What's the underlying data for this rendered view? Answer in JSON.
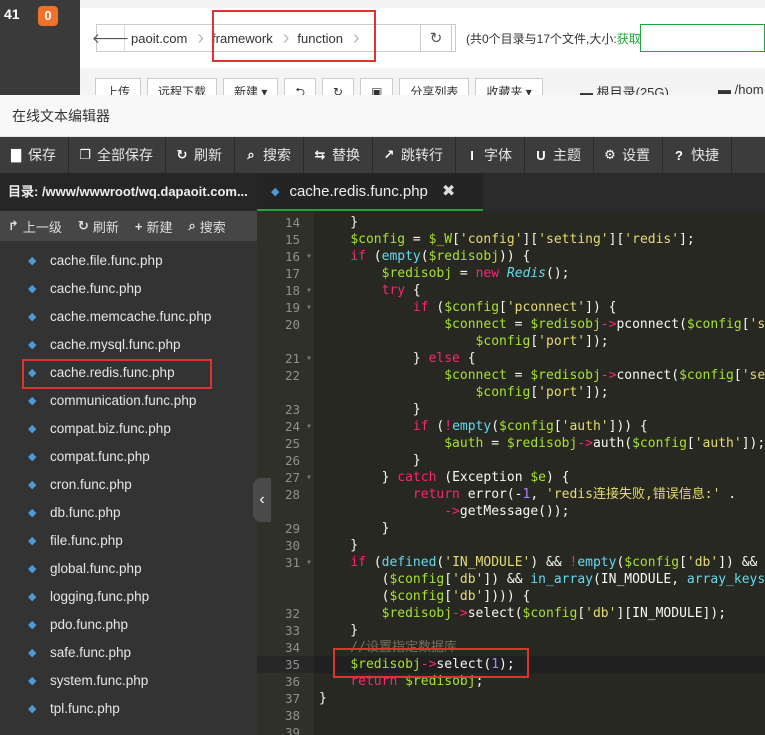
{
  "background": {
    "counter": "41",
    "badge": "0",
    "breadcrumb": [
      "paoit.com",
      "framework",
      "function"
    ],
    "info_text": "(共0个目录与17个文件,大小:",
    "info_action": "获取",
    "toolbar": [
      "上传",
      "远程下载",
      "新建 ▾",
      "⮌",
      "↻",
      "▣",
      "分享列表",
      "收藏夹 ▾"
    ],
    "root_dir": "根目录(25G)",
    "home_dir": "/hom"
  },
  "modal": {
    "title": "在线文本编辑器",
    "toolbar": [
      {
        "icon": "save-icon",
        "glyph": "▇",
        "label": "保存"
      },
      {
        "icon": "save-all-icon",
        "glyph": "❐",
        "label": "全部保存"
      },
      {
        "icon": "refresh-icon",
        "glyph": "↻",
        "label": "刷新"
      },
      {
        "icon": "search-icon",
        "glyph": "⌕",
        "label": "搜索"
      },
      {
        "icon": "replace-icon",
        "glyph": "⇆",
        "label": "替换"
      },
      {
        "icon": "goto-line-icon",
        "glyph": "↗",
        "label": "跳转行"
      },
      {
        "icon": "font-icon",
        "glyph": "I",
        "label": "字体"
      },
      {
        "icon": "theme-icon",
        "glyph": "U",
        "label": "主题"
      },
      {
        "icon": "settings-icon",
        "glyph": "⚙",
        "label": "设置"
      },
      {
        "icon": "shortcut-icon",
        "glyph": "?",
        "label": "快捷"
      }
    ],
    "sidebar": {
      "directory": "目录: /www/wwwroot/wq.dapaoit.com...",
      "tools": [
        {
          "icon": "up-level-icon",
          "glyph": "↱",
          "label": "上一级"
        },
        {
          "icon": "refresh-icon",
          "glyph": "↻",
          "label": "刷新"
        },
        {
          "icon": "plus-icon",
          "glyph": "+",
          "label": "新建"
        },
        {
          "icon": "search-icon",
          "glyph": "⌕",
          "label": "搜索"
        }
      ],
      "files": [
        "cache.file.func.php",
        "cache.func.php",
        "cache.memcache.func.php",
        "cache.mysql.func.php",
        "cache.redis.func.php",
        "communication.func.php",
        "compat.biz.func.php",
        "compat.func.php",
        "cron.func.php",
        "db.func.php",
        "file.func.php",
        "global.func.php",
        "logging.func.php",
        "pdo.func.php",
        "safe.func.php",
        "system.func.php",
        "tpl.func.php"
      ]
    },
    "tab": {
      "label": "cache.redis.func.php",
      "close": "✖"
    },
    "editor": {
      "gutter": [
        {
          "n": "14",
          "fold": false
        },
        {
          "n": "15",
          "fold": false
        },
        {
          "n": "16",
          "fold": true
        },
        {
          "n": "17",
          "fold": false
        },
        {
          "n": "18",
          "fold": true
        },
        {
          "n": "19",
          "fold": true
        },
        {
          "n": "20",
          "fold": false
        },
        {
          "n": "",
          "fold": false
        },
        {
          "n": "21",
          "fold": true
        },
        {
          "n": "22",
          "fold": false
        },
        {
          "n": "",
          "fold": false
        },
        {
          "n": "23",
          "fold": false
        },
        {
          "n": "24",
          "fold": true
        },
        {
          "n": "25",
          "fold": false
        },
        {
          "n": "26",
          "fold": false
        },
        {
          "n": "27",
          "fold": true
        },
        {
          "n": "28",
          "fold": false
        },
        {
          "n": "",
          "fold": false
        },
        {
          "n": "29",
          "fold": false
        },
        {
          "n": "30",
          "fold": false
        },
        {
          "n": "31",
          "fold": true
        },
        {
          "n": "",
          "fold": false
        },
        {
          "n": "",
          "fold": false
        },
        {
          "n": "32",
          "fold": false
        },
        {
          "n": "33",
          "fold": false
        },
        {
          "n": "34",
          "fold": false
        },
        {
          "n": "35",
          "fold": false
        },
        {
          "n": "36",
          "fold": false
        },
        {
          "n": "37",
          "fold": false
        },
        {
          "n": "38",
          "fold": false
        },
        {
          "n": "39",
          "fold": false
        }
      ],
      "lines": [
        [
          [
            "pl",
            "    }"
          ]
        ],
        [
          [
            "pl",
            "    "
          ],
          [
            "var",
            "$config"
          ],
          [
            "pl",
            " = "
          ],
          [
            "var",
            "$_W"
          ],
          [
            "pl",
            "["
          ],
          [
            "str",
            "'config'"
          ],
          [
            "pl",
            "]["
          ],
          [
            "str",
            "'setting'"
          ],
          [
            "pl",
            "]["
          ],
          [
            "str",
            "'redis'"
          ],
          [
            "pl",
            "];"
          ]
        ],
        [
          [
            "pl",
            "    "
          ],
          [
            "kw",
            "if"
          ],
          [
            "pl",
            " ("
          ],
          [
            "fn",
            "empty"
          ],
          [
            "pl",
            "("
          ],
          [
            "var",
            "$redisobj"
          ],
          [
            "pl",
            ")) {"
          ]
        ],
        [
          [
            "pl",
            "        "
          ],
          [
            "var",
            "$redisobj"
          ],
          [
            "pl",
            " = "
          ],
          [
            "kw",
            "new"
          ],
          [
            "pl",
            " "
          ],
          [
            "cls",
            "Redis"
          ],
          [
            "pl",
            "();"
          ]
        ],
        [
          [
            "pl",
            "        "
          ],
          [
            "kw",
            "try"
          ],
          [
            "pl",
            " {"
          ]
        ],
        [
          [
            "pl",
            "            "
          ],
          [
            "kw",
            "if"
          ],
          [
            "pl",
            " ("
          ],
          [
            "var",
            "$config"
          ],
          [
            "pl",
            "["
          ],
          [
            "str",
            "'pconnect'"
          ],
          [
            "pl",
            "]) {"
          ]
        ],
        [
          [
            "pl",
            "                "
          ],
          [
            "var",
            "$connect"
          ],
          [
            "pl",
            " = "
          ],
          [
            "var",
            "$redisobj"
          ],
          [
            "kw",
            "->"
          ],
          [
            "pl",
            "pconnect("
          ],
          [
            "var",
            "$config"
          ],
          [
            "pl",
            "["
          ],
          [
            "str",
            "'se"
          ]
        ],
        [
          [
            "pl",
            "                    "
          ],
          [
            "var",
            "$config"
          ],
          [
            "pl",
            "["
          ],
          [
            "str",
            "'port'"
          ],
          [
            "pl",
            "]);"
          ]
        ],
        [
          [
            "pl",
            "            } "
          ],
          [
            "kw",
            "else"
          ],
          [
            "pl",
            " {"
          ]
        ],
        [
          [
            "pl",
            "                "
          ],
          [
            "var",
            "$connect"
          ],
          [
            "pl",
            " = "
          ],
          [
            "var",
            "$redisobj"
          ],
          [
            "kw",
            "->"
          ],
          [
            "pl",
            "connect("
          ],
          [
            "var",
            "$config"
          ],
          [
            "pl",
            "["
          ],
          [
            "str",
            "'ser"
          ]
        ],
        [
          [
            "pl",
            "                    "
          ],
          [
            "var",
            "$config"
          ],
          [
            "pl",
            "["
          ],
          [
            "str",
            "'port'"
          ],
          [
            "pl",
            "]);"
          ]
        ],
        [
          [
            "pl",
            "            }"
          ]
        ],
        [
          [
            "pl",
            "            "
          ],
          [
            "kw",
            "if"
          ],
          [
            "pl",
            " ("
          ],
          [
            "kw",
            "!"
          ],
          [
            "fn",
            "empty"
          ],
          [
            "pl",
            "("
          ],
          [
            "var",
            "$config"
          ],
          [
            "pl",
            "["
          ],
          [
            "str",
            "'auth'"
          ],
          [
            "pl",
            "])) {"
          ]
        ],
        [
          [
            "pl",
            "                "
          ],
          [
            "var",
            "$auth"
          ],
          [
            "pl",
            " = "
          ],
          [
            "var",
            "$redisobj"
          ],
          [
            "kw",
            "->"
          ],
          [
            "pl",
            "auth("
          ],
          [
            "var",
            "$config"
          ],
          [
            "pl",
            "["
          ],
          [
            "str",
            "'auth'"
          ],
          [
            "pl",
            "]);"
          ]
        ],
        [
          [
            "pl",
            "            }"
          ]
        ],
        [
          [
            "pl",
            "        } "
          ],
          [
            "kw",
            "catch"
          ],
          [
            "pl",
            " (Exception "
          ],
          [
            "var",
            "$e"
          ],
          [
            "pl",
            ") {"
          ]
        ],
        [
          [
            "pl",
            "            "
          ],
          [
            "kw",
            "return"
          ],
          [
            "pl",
            " error(-"
          ],
          [
            "num",
            "1"
          ],
          [
            "pl",
            ", "
          ],
          [
            "str",
            "'redis连接失败,错误信息:'"
          ],
          [
            "pl",
            " ."
          ]
        ],
        [
          [
            "pl",
            "                "
          ],
          [
            "kw",
            "->"
          ],
          [
            "pl",
            "getMessage());"
          ]
        ],
        [
          [
            "pl",
            "        }"
          ]
        ],
        [
          [
            "pl",
            "    }"
          ]
        ],
        [
          [
            "pl",
            "    "
          ],
          [
            "kw",
            "if"
          ],
          [
            "pl",
            " ("
          ],
          [
            "fn",
            "defined"
          ],
          [
            "pl",
            "("
          ],
          [
            "str",
            "'IN_MODULE'"
          ],
          [
            "pl",
            ") && "
          ],
          [
            "kw",
            "!"
          ],
          [
            "fn",
            "empty"
          ],
          [
            "pl",
            "("
          ],
          [
            "var",
            "$config"
          ],
          [
            "pl",
            "["
          ],
          [
            "str",
            "'db'"
          ],
          [
            "pl",
            "]) && i"
          ]
        ],
        [
          [
            "pl",
            "        ("
          ],
          [
            "var",
            "$config"
          ],
          [
            "pl",
            "["
          ],
          [
            "str",
            "'db'"
          ],
          [
            "pl",
            "]) && "
          ],
          [
            "fn",
            "in_array"
          ],
          [
            "pl",
            "(IN_MODULE, "
          ],
          [
            "fn",
            "array_keys"
          ]
        ],
        [
          [
            "pl",
            "        ("
          ],
          [
            "var",
            "$config"
          ],
          [
            "pl",
            "["
          ],
          [
            "str",
            "'db'"
          ],
          [
            "pl",
            "]))) {"
          ]
        ],
        [
          [
            "pl",
            "        "
          ],
          [
            "var",
            "$redisobj"
          ],
          [
            "kw",
            "->"
          ],
          [
            "pl",
            "select("
          ],
          [
            "var",
            "$config"
          ],
          [
            "pl",
            "["
          ],
          [
            "str",
            "'db'"
          ],
          [
            "pl",
            "][IN_MODULE]);"
          ]
        ],
        [
          [
            "pl",
            "    }"
          ]
        ],
        [
          [
            "cm",
            "    //设置指定数据库"
          ]
        ],
        [
          [
            "pl",
            "    "
          ],
          [
            "var",
            "$redisobj"
          ],
          [
            "kw",
            "->"
          ],
          [
            "pl",
            "select("
          ],
          [
            "num",
            "1"
          ],
          [
            "pl",
            ");"
          ]
        ],
        [
          [
            "pl",
            "    "
          ],
          [
            "kw",
            "return"
          ],
          [
            "pl",
            " "
          ],
          [
            "var",
            "$redisobj"
          ],
          [
            "pl",
            ";"
          ]
        ],
        [
          [
            "pl",
            "}"
          ]
        ],
        [
          [
            "pl",
            ""
          ]
        ],
        [
          [
            "pl",
            ""
          ]
        ]
      ]
    }
  }
}
